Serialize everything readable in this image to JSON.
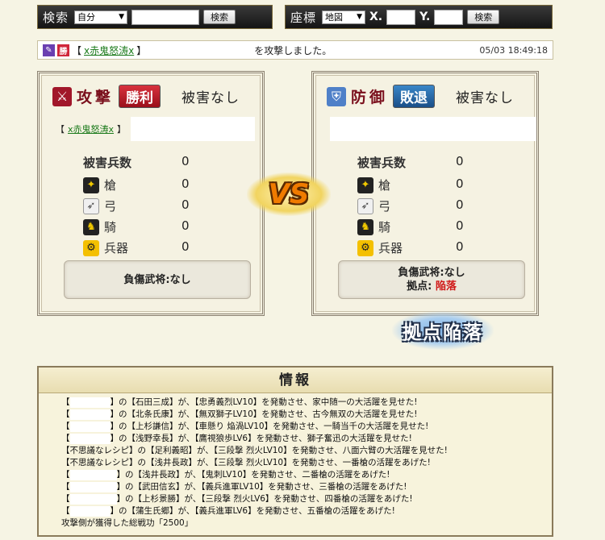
{
  "search_bar": {
    "title": "検索",
    "select_value": "自分",
    "input_value": "",
    "button": "検索"
  },
  "coord_bar": {
    "title": "座標",
    "select_value": "地図",
    "x_label": "X.",
    "x_value": "",
    "y_label": "Y.",
    "y_value": "",
    "button": "検索"
  },
  "report": {
    "badge_win": "勝",
    "attacker_name": "x赤鬼怒涛x",
    "bracket_open": "【",
    "bracket_close": "】",
    "message": "を攻撃しました。",
    "timestamp": "05/03 18:49:18"
  },
  "attacker": {
    "role": "攻撃",
    "result": "勝利",
    "damage": "被害なし",
    "name": "x赤鬼怒涛x",
    "lost_label": "被害兵数",
    "lost_total": "0",
    "units": [
      {
        "label": "槍",
        "value": "0",
        "icon": "spear-icon"
      },
      {
        "label": "弓",
        "value": "0",
        "icon": "bow-icon"
      },
      {
        "label": "騎",
        "value": "0",
        "icon": "horse-icon"
      },
      {
        "label": "兵器",
        "value": "0",
        "icon": "siege-icon"
      }
    ],
    "officer": "負傷武将:なし"
  },
  "defender": {
    "role": "防御",
    "result": "敗退",
    "damage": "被害なし",
    "lost_label": "被害兵数",
    "lost_total": "0",
    "units": [
      {
        "label": "槍",
        "value": "0",
        "icon": "spear-icon"
      },
      {
        "label": "弓",
        "value": "0",
        "icon": "bow-icon"
      },
      {
        "label": "騎",
        "value": "0",
        "icon": "horse-icon"
      },
      {
        "label": "兵器",
        "value": "0",
        "icon": "siege-icon"
      }
    ],
    "officer": "負傷武将:なし",
    "base_label": "拠点:",
    "base_status": "陥落"
  },
  "vs_label": "VS",
  "stamp_label": "拠点陥落",
  "info": {
    "title": "情報",
    "lines": [
      {
        "player": "",
        "text": "の【石田三成】が、【忠勇義烈LV10】を発動させ、家中随一の大活躍を見せた!"
      },
      {
        "player": "",
        "text": "の【北条氏康】が、【無双獅子LV10】を発動させ、古今無双の大活躍を見せた!"
      },
      {
        "player": "",
        "text": "の【上杉謙信】が、【車懸り 焔渦LV10】を発動させ、一騎当千の大活躍を見せた!"
      },
      {
        "player": "",
        "text": "の【浅野幸長】が、【鷹視狼歩LV6】を発動させ、獅子奮迅の大活躍を見せた!"
      },
      {
        "player": "不思議なレシピ",
        "text": "の【足利義昭】が、【三段撃 烈火LV10】を発動させ、八面六臂の大活躍を見せた!"
      },
      {
        "player": "不思議なレシピ",
        "text": "の【浅井長政】が、【三段撃 烈火LV10】を発動させ、一番槍の活躍をあげた!"
      },
      {
        "player": "",
        "text": "の【浅井長政】が、【鬼刺LV10】を発動させ、二番槍の活躍をあげた!"
      },
      {
        "player": "",
        "text": "の【武田信玄】が、【義兵進軍LV10】を発動させ、三番槍の活躍をあげた!"
      },
      {
        "player": "",
        "text": "の【上杉景勝】が、【三段撃 烈火LV6】を発動させ、四番槍の活躍をあげた!"
      },
      {
        "player": "",
        "text": "の【蒲生氏郷】が、【義兵進軍LV6】を発動させ、五番槍の活躍をあげた!"
      }
    ],
    "summary": "攻撃側が獲得した総戦功「2500」"
  }
}
